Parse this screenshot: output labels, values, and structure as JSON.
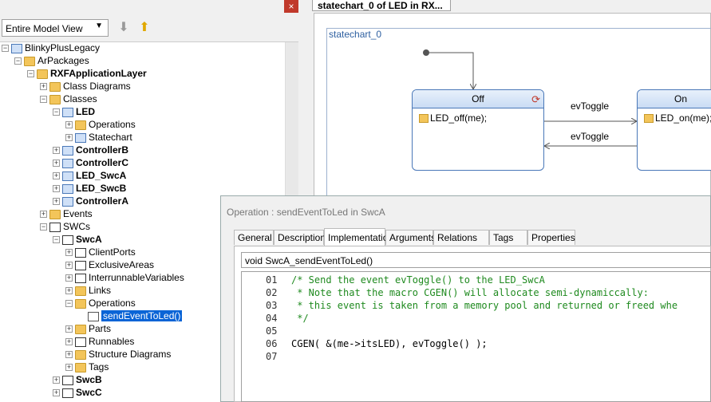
{
  "toolbar": {
    "close_glyph": "×",
    "view_select": "Entire Model View",
    "down_arrow": "⬇",
    "up_arrow": "⬆"
  },
  "tree": [
    {
      "label": "BlinkyPlusLegacy",
      "icon": "project-icon",
      "bold": false
    },
    {
      "label": "ArPackages",
      "icon": "folder-icon",
      "bold": false
    },
    {
      "label": "RXFApplicationLayer",
      "icon": "package-icon",
      "bold": true
    },
    {
      "label": "Class Diagrams",
      "icon": "folder-icon",
      "bold": false
    },
    {
      "label": "Classes",
      "icon": "folder-icon",
      "bold": false
    },
    {
      "label": "LED",
      "icon": "class-icon",
      "bold": true
    },
    {
      "label": "Operations",
      "icon": "folder-icon",
      "bold": false
    },
    {
      "label": "Statechart",
      "icon": "statechart-icon",
      "bold": false
    },
    {
      "label": "ControllerB",
      "icon": "class-icon",
      "bold": true
    },
    {
      "label": "ControllerC",
      "icon": "class-icon",
      "bold": true
    },
    {
      "label": "LED_SwcA",
      "icon": "class-icon",
      "bold": true
    },
    {
      "label": "LED_SwcB",
      "icon": "class-icon",
      "bold": true
    },
    {
      "label": "ControllerA",
      "icon": "class-icon",
      "bold": true
    },
    {
      "label": "Events",
      "icon": "folder-icon",
      "bold": false
    },
    {
      "label": "SWCs",
      "icon": "box-icon",
      "bold": false
    },
    {
      "label": "SwcA",
      "icon": "box-icon",
      "bold": true
    },
    {
      "label": "ClientPorts",
      "icon": "port-icon",
      "bold": false
    },
    {
      "label": "ExclusiveAreas",
      "icon": "exclusive-area-icon",
      "bold": false
    },
    {
      "label": "InterrunnableVariables",
      "icon": "variable-icon",
      "bold": false
    },
    {
      "label": "Links",
      "icon": "folder-icon",
      "bold": false
    },
    {
      "label": "Operations",
      "icon": "folder-icon",
      "bold": false
    },
    {
      "label": "sendEventToLed()",
      "icon": "operation-icon",
      "bold": false,
      "selected": true
    },
    {
      "label": "Parts",
      "icon": "folder-icon",
      "bold": false
    },
    {
      "label": "Runnables",
      "icon": "runnable-icon",
      "bold": false
    },
    {
      "label": "Structure Diagrams",
      "icon": "folder-icon",
      "bold": false
    },
    {
      "label": "Tags",
      "icon": "folder-icon",
      "bold": false
    },
    {
      "label": "SwcB",
      "icon": "box-icon",
      "bold": true
    },
    {
      "label": "SwcC",
      "icon": "box-icon",
      "bold": true
    }
  ],
  "statechart": {
    "tab_title": "statechart_0 of LED in RX...",
    "frame_label": "statechart_0",
    "state_off": {
      "name": "Off",
      "action": "LED_off(me);"
    },
    "state_on": {
      "name": "On",
      "action": "LED_on(me);"
    },
    "transition_top": "evToggle",
    "transition_bottom": "evToggle"
  },
  "dialog": {
    "title": "Operation : sendEventToLed in SwcA",
    "tabs": [
      "General",
      "Description",
      "Implementation",
      "Arguments",
      "Relations",
      "Tags",
      "Properties"
    ],
    "active_tab": "Implementation",
    "signature": "void SwcA_sendEventToLed()",
    "code_lines": [
      {
        "n": "01",
        "text": "/* Send the event evToggle() to the LED_SwcA",
        "type": "comment"
      },
      {
        "n": "02",
        "text": " * Note that the macro CGEN() will allocate semi-dynamiccally:",
        "type": "comment"
      },
      {
        "n": "03",
        "text": " * this event is taken from a memory pool and returned or freed whe",
        "type": "comment"
      },
      {
        "n": "04",
        "text": " */",
        "type": "comment"
      },
      {
        "n": "05",
        "text": "",
        "type": "code"
      },
      {
        "n": "06",
        "text": "CGEN( &(me->itsLED), evToggle() );",
        "type": "code"
      },
      {
        "n": "07",
        "text": "",
        "type": "code"
      }
    ]
  },
  "colors": {
    "selection": "#0a64d6",
    "comment": "#1f8a1f",
    "state_border": "#4a78b8"
  }
}
